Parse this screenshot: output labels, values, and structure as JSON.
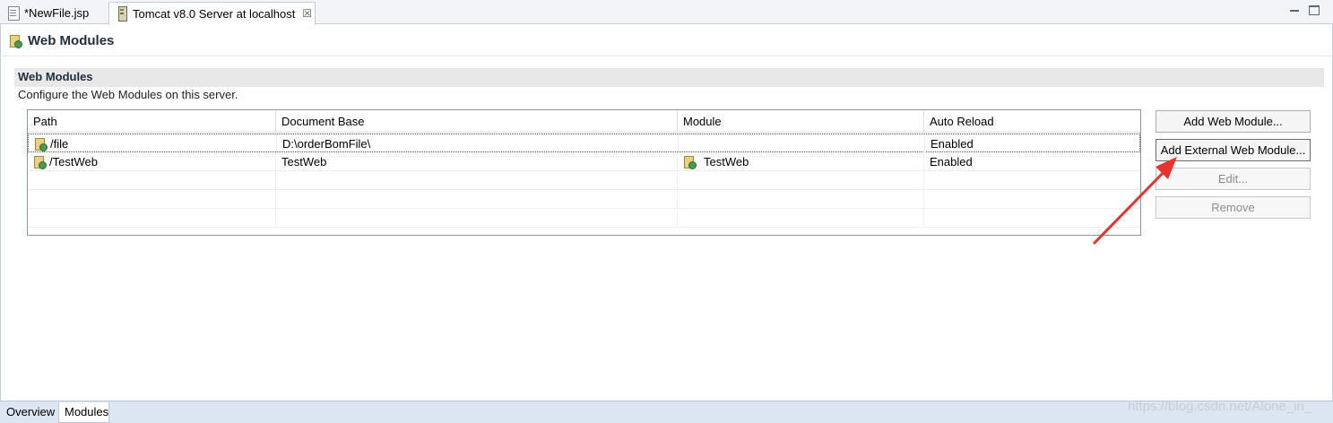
{
  "editor_tabs": [
    {
      "label": "*NewFile.jsp",
      "icon": "jsp-file-icon"
    },
    {
      "label": "Tomcat v8.0 Server at localhost",
      "icon": "server-icon",
      "close": "☒"
    }
  ],
  "page": {
    "title": "Web Modules"
  },
  "section": {
    "title": "Web Modules",
    "description": "Configure the Web Modules on this server."
  },
  "table": {
    "columns": [
      "Path",
      "Document Base",
      "Module",
      "Auto Reload"
    ],
    "rows": [
      {
        "path": "/file",
        "document_base": "D:\\orderBomFile\\",
        "module": "",
        "auto_reload": "Enabled"
      },
      {
        "path": "/TestWeb",
        "document_base": "TestWeb",
        "module": "TestWeb",
        "auto_reload": "Enabled"
      }
    ]
  },
  "buttons": {
    "add_web_module": "Add Web Module...",
    "add_external_web_module": "Add External Web Module...",
    "edit": "Edit...",
    "remove": "Remove"
  },
  "bottom_tabs": [
    "Overview",
    "Modules"
  ],
  "watermark": "https://blog.csdn.net/Alone_in_",
  "colors": {
    "annotation_arrow": "#e8322b",
    "bottom_bar": "#dce6f2",
    "section_header": "#e8e8e8"
  }
}
